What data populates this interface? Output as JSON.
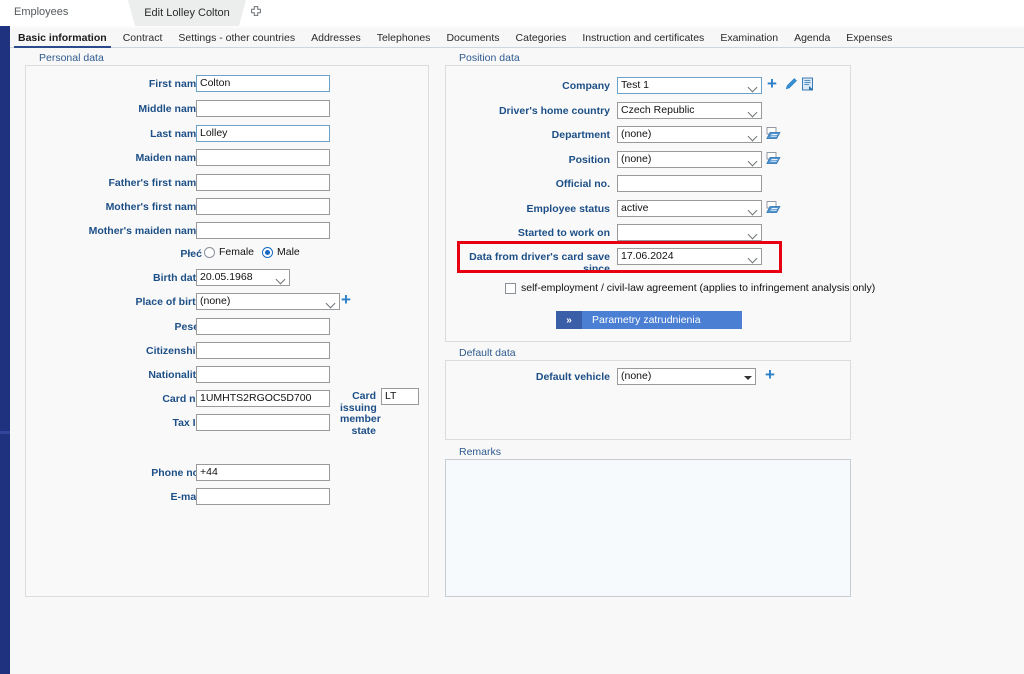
{
  "window": {
    "app_label": "Employees",
    "document_tab": "Edit Lolley Colton",
    "add_tab_icon": "plus-icon",
    "rail_color": "#1f3280"
  },
  "tabs": [
    {
      "label": "Basic information",
      "active": true
    },
    {
      "label": "Contract",
      "active": false
    },
    {
      "label": "Settings - other countries",
      "active": false
    },
    {
      "label": "Addresses",
      "active": false
    },
    {
      "label": "Telephones",
      "active": false
    },
    {
      "label": "Documents",
      "active": false
    },
    {
      "label": "Categories",
      "active": false
    },
    {
      "label": "Instruction and certificates",
      "active": false
    },
    {
      "label": "Examination",
      "active": false
    },
    {
      "label": "Agenda",
      "active": false
    },
    {
      "label": "Expenses",
      "active": false
    }
  ],
  "personal_data": {
    "title": "Personal data",
    "fields": {
      "first_name": {
        "label": "First name",
        "value": "Colton"
      },
      "middle_name": {
        "label": "Middle name",
        "value": ""
      },
      "last_name": {
        "label": "Last name",
        "value": "Lolley"
      },
      "maiden_name": {
        "label": "Maiden name",
        "value": ""
      },
      "fathers_first_name": {
        "label": "Father's first name",
        "value": ""
      },
      "mothers_first_name": {
        "label": "Mother's first name",
        "value": ""
      },
      "mothers_maiden_name": {
        "label": "Mother's maiden name",
        "value": ""
      },
      "sex": {
        "label": "Płeć",
        "female_label": "Female",
        "male_label": "Male",
        "selected": "Male"
      },
      "birth_date": {
        "label": "Birth date",
        "value": "20.05.1968"
      },
      "place_of_birth": {
        "label": "Place of birth",
        "value": "(none)"
      },
      "pesel": {
        "label": "Pesel",
        "value": ""
      },
      "citizenship": {
        "label": "Citizenship",
        "value": ""
      },
      "nationality": {
        "label": "Nationality",
        "value": ""
      },
      "card_no": {
        "label": "Card no",
        "value": "1UMHTS2RGOC5D700"
      },
      "card_issuing_member_state": {
        "label": "Card issuing member state",
        "value": "LT"
      },
      "tax_id": {
        "label": "Tax Id",
        "value": ""
      },
      "phone_no": {
        "label": "Phone no.",
        "value": "+44"
      },
      "email": {
        "label": "E-mail",
        "value": ""
      }
    }
  },
  "position_data": {
    "title": "Position data",
    "fields": {
      "company": {
        "label": "Company",
        "value": "Test 1"
      },
      "drivers_home_country": {
        "label": "Driver's home country",
        "value": "Czech Republic"
      },
      "department": {
        "label": "Department",
        "value": "(none)"
      },
      "position": {
        "label": "Position",
        "value": "(none)"
      },
      "official_no": {
        "label": "Official no.",
        "value": ""
      },
      "employee_status": {
        "label": "Employee status",
        "value": "active"
      },
      "started_to_work_on": {
        "label": "Started to work on",
        "value": ""
      },
      "card_save_since": {
        "label": "Data from driver's card save since",
        "value": "17.06.2024",
        "highlight_color": "#e60012"
      }
    },
    "self_employment_checkbox": {
      "label": "self-employment / civil-law agreement (applies to infringement analysis only)",
      "checked": false
    },
    "action_button": {
      "label": "Parametry zatrudnienia",
      "chevron": "»",
      "color": "#4a7fd4"
    },
    "icons": {
      "add": "plus-icon",
      "edit": "pencil-icon",
      "details": "document-icon",
      "list": "list-picker-icon"
    }
  },
  "default_data": {
    "title": "Default data",
    "fields": {
      "default_vehicle": {
        "label": "Default vehicle",
        "value": "(none)"
      }
    }
  },
  "remarks": {
    "title": "Remarks",
    "value": ""
  }
}
